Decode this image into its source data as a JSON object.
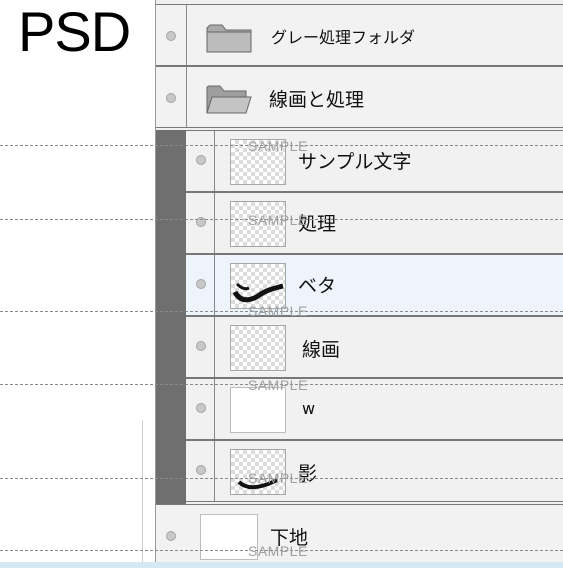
{
  "label": "PSD",
  "watermark": "SAMPLE",
  "layers": {
    "folder1": {
      "name": "グレー処理フォルダ",
      "icon": "closed-folder-icon"
    },
    "folder2": {
      "name": "線画と処理",
      "icon": "open-folder-icon"
    },
    "children": [
      {
        "name": "サンプル文字"
      },
      {
        "name": "処理"
      },
      {
        "name": "ベタ"
      },
      {
        "name": "線画"
      },
      {
        "name": "w"
      },
      {
        "name": "影"
      }
    ],
    "base": {
      "name": "下地"
    }
  }
}
